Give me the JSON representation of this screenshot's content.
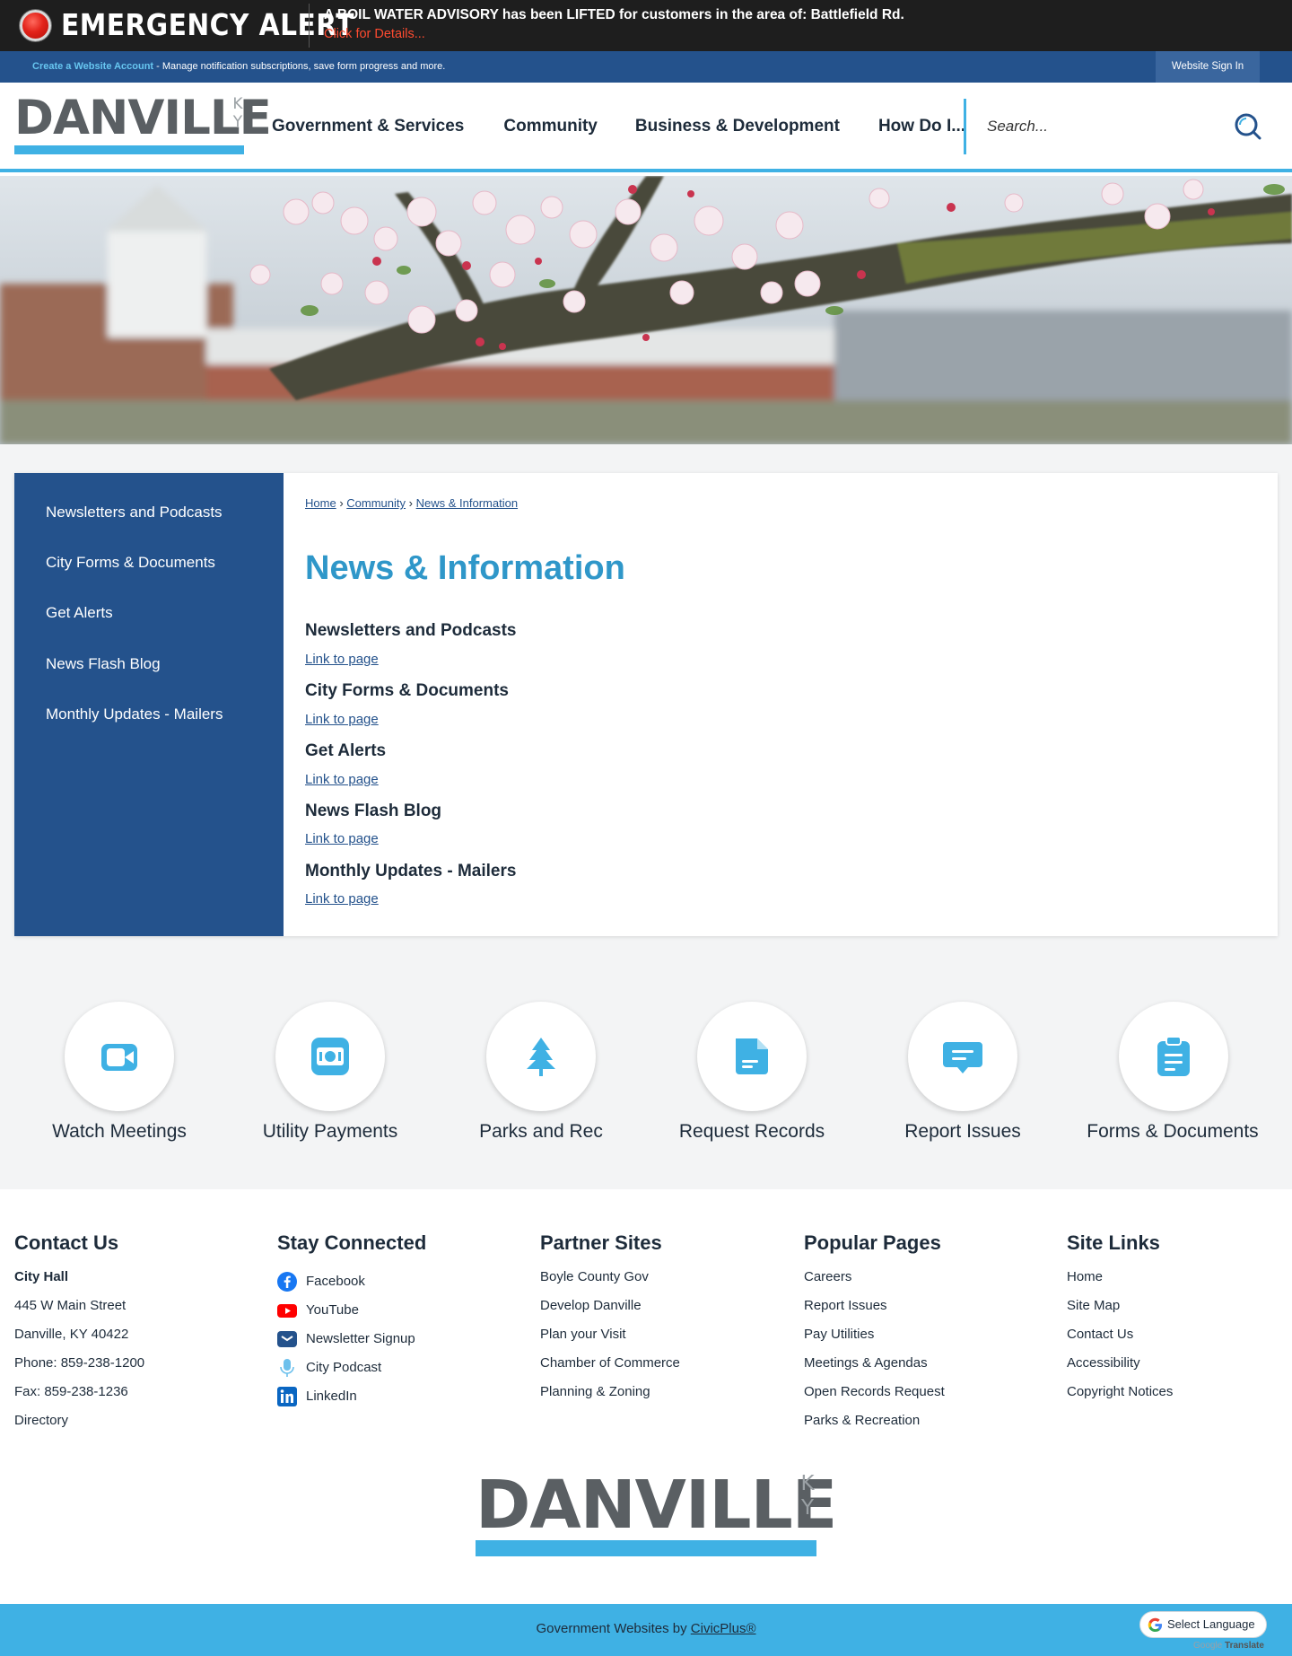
{
  "alert": {
    "title": "EMERGENCY ALERT",
    "message": "A BOIL WATER ADVISORY has been LIFTED for customers in the area of: Battlefield Rd.",
    "details_link": "Click for Details..."
  },
  "account_bar": {
    "create_link": "Create a Website Account",
    "description": " - Manage notification subscriptions, save form progress and more.",
    "signin": "Website Sign In"
  },
  "logo": {
    "word": "DANVILLE",
    "state_k": "K",
    "state_y": "Y"
  },
  "nav": {
    "items": [
      "Government & Services",
      "Community",
      "Business & Development",
      "How Do I..."
    ]
  },
  "search": {
    "placeholder": "Search..."
  },
  "sidebar": {
    "items": [
      "Newsletters and Podcasts",
      "City Forms & Documents",
      "Get Alerts",
      "News Flash Blog",
      "Monthly Updates - Mailers"
    ]
  },
  "breadcrumb": {
    "home": "Home",
    "community": "Community",
    "current": "News & Information",
    "sep": "›"
  },
  "page": {
    "title": "News & Information",
    "entries": [
      {
        "title": "Newsletters and Podcasts",
        "link": "Link to page"
      },
      {
        "title": "City Forms & Documents",
        "link": "Link to page"
      },
      {
        "title": "Get Alerts",
        "link": "Link to page"
      },
      {
        "title": "News Flash Blog",
        "link": "Link to page"
      },
      {
        "title": "Monthly Updates - Mailers",
        "link": "Link to page"
      }
    ]
  },
  "quick_links": [
    {
      "label": "Watch Meetings",
      "icon": "video-camera-icon"
    },
    {
      "label": "Utility Payments",
      "icon": "payment-icon"
    },
    {
      "label": "Parks and Rec",
      "icon": "tree-icon"
    },
    {
      "label": "Request Records",
      "icon": "document-icon"
    },
    {
      "label": "Report Issues",
      "icon": "chat-bubble-icon"
    },
    {
      "label": "Forms & Documents",
      "icon": "clipboard-icon"
    }
  ],
  "footer": {
    "contact": {
      "heading": "Contact Us",
      "lines": [
        "City Hall",
        "445 W Main Street",
        "Danville, KY 40422",
        "Phone: 859-238-1200",
        "Fax: 859-238-1236",
        "Directory"
      ]
    },
    "stay_connected": {
      "heading": "Stay Connected",
      "items": [
        {
          "label": "Facebook",
          "icon": "facebook-icon"
        },
        {
          "label": "YouTube",
          "icon": "youtube-icon"
        },
        {
          "label": "Newsletter Signup",
          "icon": "envelope-icon"
        },
        {
          "label": "City Podcast",
          "icon": "microphone-icon"
        },
        {
          "label": "LinkedIn",
          "icon": "linkedin-icon"
        }
      ]
    },
    "partner_sites": {
      "heading": "Partner Sites",
      "items": [
        "Boyle County Gov",
        "Develop Danville",
        "Plan your Visit",
        "Chamber of Commerce",
        "Planning & Zoning"
      ]
    },
    "popular_pages": {
      "heading": "Popular Pages",
      "items": [
        "Careers",
        "Report Issues",
        "Pay Utilities",
        "Meetings & Agendas",
        "Open Records Request",
        "Parks & Recreation"
      ]
    },
    "site_links": {
      "heading": "Site Links",
      "items": [
        "Home",
        "Site Map",
        "Contact Us",
        "Accessibility",
        "Copyright Notices"
      ]
    }
  },
  "bottom": {
    "prefix": "Government Websites by ",
    "link": "CivicPlus®",
    "language": "Select Language",
    "translate_brand": "Google",
    "translate_word": "Translate"
  },
  "colors": {
    "navy": "#24528c",
    "accent_blue": "#3fb1e4",
    "title_blue": "#2f97c9",
    "alert_red": "#ff4b30"
  }
}
